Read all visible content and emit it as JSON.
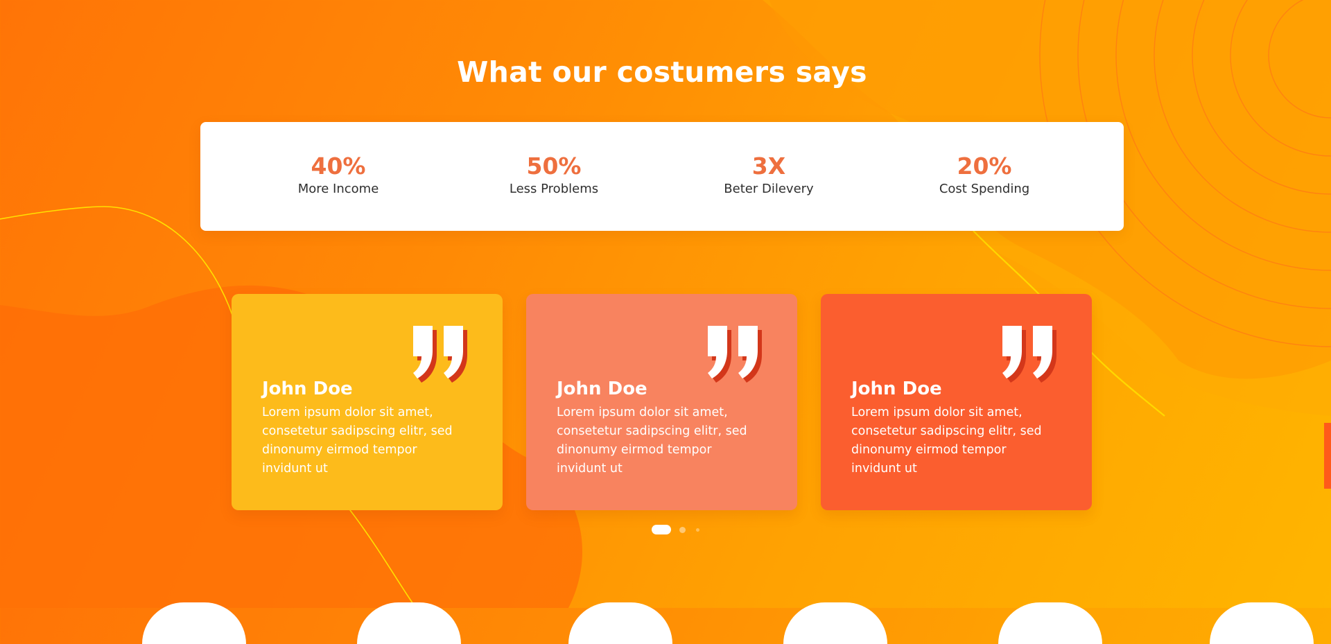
{
  "section": {
    "title": "What our costumers says"
  },
  "stats": [
    {
      "value": "40%",
      "label": "More Income"
    },
    {
      "value": "50%",
      "label": "Less Problems"
    },
    {
      "value": "3X",
      "label": "Beter Dilevery"
    },
    {
      "value": "20%",
      "label": "Cost Spending"
    }
  ],
  "testimonials": [
    {
      "name": "John Doe",
      "text": "Lorem ipsum dolor sit amet, consetetur sadipscing elitr, sed dinonumy eirmod tempor invidunt ut",
      "color": "#fdbb1b"
    },
    {
      "name": "John Doe",
      "text": "Lorem ipsum dolor sit amet, consetetur sadipscing elitr, sed dinonumy eirmod tempor invidunt ut",
      "color": "#f8835f"
    },
    {
      "name": "John Doe",
      "text": "Lorem ipsum dolor sit amet, consetetur sadipscing elitr, sed dinonumy eirmod tempor invidunt ut",
      "color": "#fb5e2f"
    }
  ],
  "carousel": {
    "active_index": 0,
    "dot_count": 3
  },
  "colors": {
    "accent": "#ee6f3e",
    "quote_shadow": "#d3371a",
    "background_from": "#ff7407",
    "background_to": "#ffb500"
  },
  "icons": {
    "quote": "quote-icon"
  }
}
